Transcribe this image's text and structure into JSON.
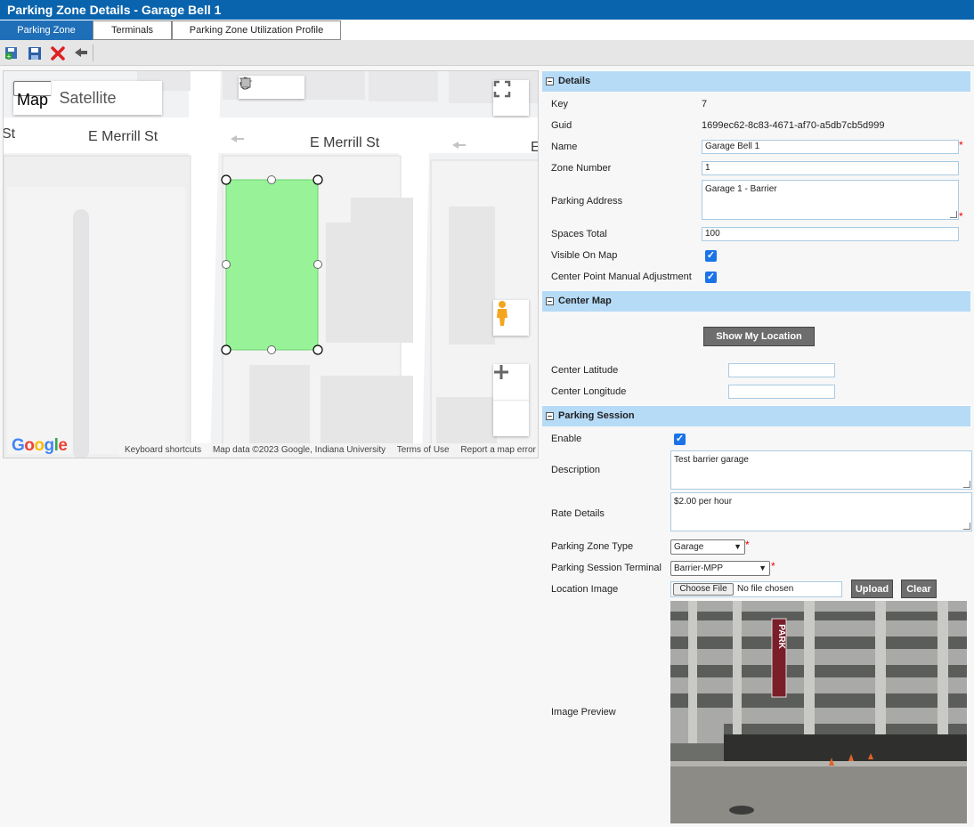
{
  "window": {
    "title": "Parking Zone Details - Garage Bell 1"
  },
  "tabs": [
    {
      "label": "Parking Zone",
      "active": true
    },
    {
      "label": "Terminals",
      "active": false
    },
    {
      "label": "Parking Zone Utilization Profile",
      "active": false
    }
  ],
  "toolbar": {
    "buttons": [
      {
        "name": "save-new-icon"
      },
      {
        "name": "save-icon"
      },
      {
        "name": "delete-icon"
      },
      {
        "name": "back-icon"
      }
    ]
  },
  "map": {
    "type_buttons": {
      "map": "Map",
      "satellite": "Satellite"
    },
    "streets": {
      "left_fragment": "St",
      "left": "E Merrill St",
      "center": "E Merrill St",
      "right_fragment": "E"
    },
    "footer": {
      "shortcuts": "Keyboard shortcuts",
      "data": "Map data ©2023 Google, Indiana University",
      "terms": "Terms of Use",
      "report": "Report a map error"
    },
    "logo": "Google",
    "polygon_color": "#8ef28e"
  },
  "details": {
    "header": "Details",
    "key_label": "Key",
    "key_value": "7",
    "guid_label": "Guid",
    "guid_value": "1699ec62-8c83-4671-af70-a5db7cb5d999",
    "name_label": "Name",
    "name_value": "Garage Bell 1",
    "zone_label": "Zone Number",
    "zone_value": "1",
    "address_label": "Parking Address",
    "address_value": "Garage 1 - Barrier",
    "spaces_label": "Spaces Total",
    "spaces_value": "100",
    "visible_label": "Visible On Map",
    "visible_checked": true,
    "center_adj_label": "Center Point Manual Adjustment",
    "center_adj_checked": true
  },
  "center_map": {
    "header": "Center Map",
    "show_button": "Show My Location",
    "lat_label": "Center Latitude",
    "lat_value": "",
    "lng_label": "Center Longitude",
    "lng_value": ""
  },
  "session": {
    "header": "Parking Session",
    "enable_label": "Enable",
    "enable_checked": true,
    "desc_label": "Description",
    "desc_value": "Test barrier garage",
    "rate_label": "Rate Details",
    "rate_value": "$2.00 per hour",
    "zone_type_label": "Parking Zone Type",
    "zone_type_value": "Garage",
    "terminal_label": "Parking Session Terminal",
    "terminal_value": "Barrier-MPP",
    "image_label": "Location Image",
    "choose_file": "Choose File",
    "no_file": "No file chosen",
    "upload_button": "Upload",
    "clear_button": "Clear",
    "preview_label": "Image Preview",
    "preview_sign": "PARK"
  },
  "required_mark": "*"
}
